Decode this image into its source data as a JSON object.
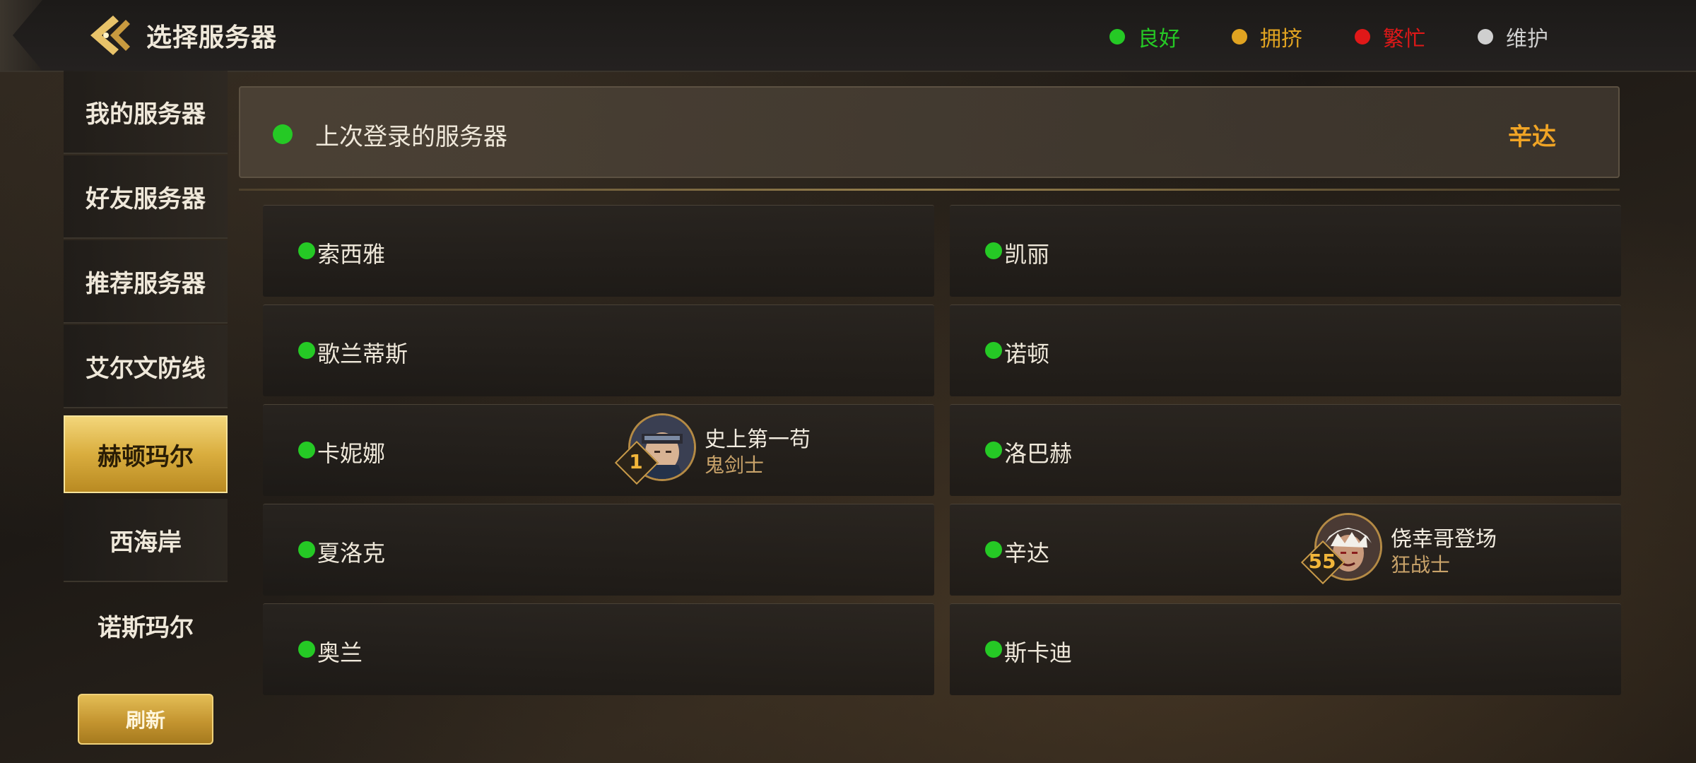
{
  "header": {
    "title": "选择服务器",
    "legend": [
      {
        "label": "良好",
        "color": "#25c925"
      },
      {
        "label": "拥挤",
        "color": "#e0a321"
      },
      {
        "label": "繁忙",
        "color": "#e01818"
      },
      {
        "label": "维护",
        "color": "#cfcfcf"
      }
    ]
  },
  "sidebar": {
    "items": [
      {
        "label": "我的服务器"
      },
      {
        "label": "好友服务器"
      },
      {
        "label": "推荐服务器"
      },
      {
        "label": "艾尔文防线"
      },
      {
        "label": "赫顿玛尔",
        "active": true
      },
      {
        "label": "西海岸"
      },
      {
        "label": "诺斯玛尔"
      }
    ],
    "refresh_label": "刷新"
  },
  "last_login": {
    "label": "上次登录的服务器",
    "server": "辛达"
  },
  "servers": [
    {
      "name": "索西雅",
      "status": "良好"
    },
    {
      "name": "凯丽",
      "status": "良好"
    },
    {
      "name": "歌兰蒂斯",
      "status": "良好"
    },
    {
      "name": "诺顿",
      "status": "良好"
    },
    {
      "name": "卡妮娜",
      "status": "良好",
      "character": {
        "name": "史上第一苟",
        "class": "鬼剑士",
        "level": "1"
      }
    },
    {
      "name": "洛巴赫",
      "status": "良好"
    },
    {
      "name": "夏洛克",
      "status": "良好"
    },
    {
      "name": "辛达",
      "status": "良好",
      "character": {
        "name": "侥幸哥登场",
        "class": "狂战士",
        "level": "55"
      }
    },
    {
      "name": "奥兰",
      "status": "良好"
    },
    {
      "name": "斯卡迪",
      "status": "良好"
    }
  ]
}
